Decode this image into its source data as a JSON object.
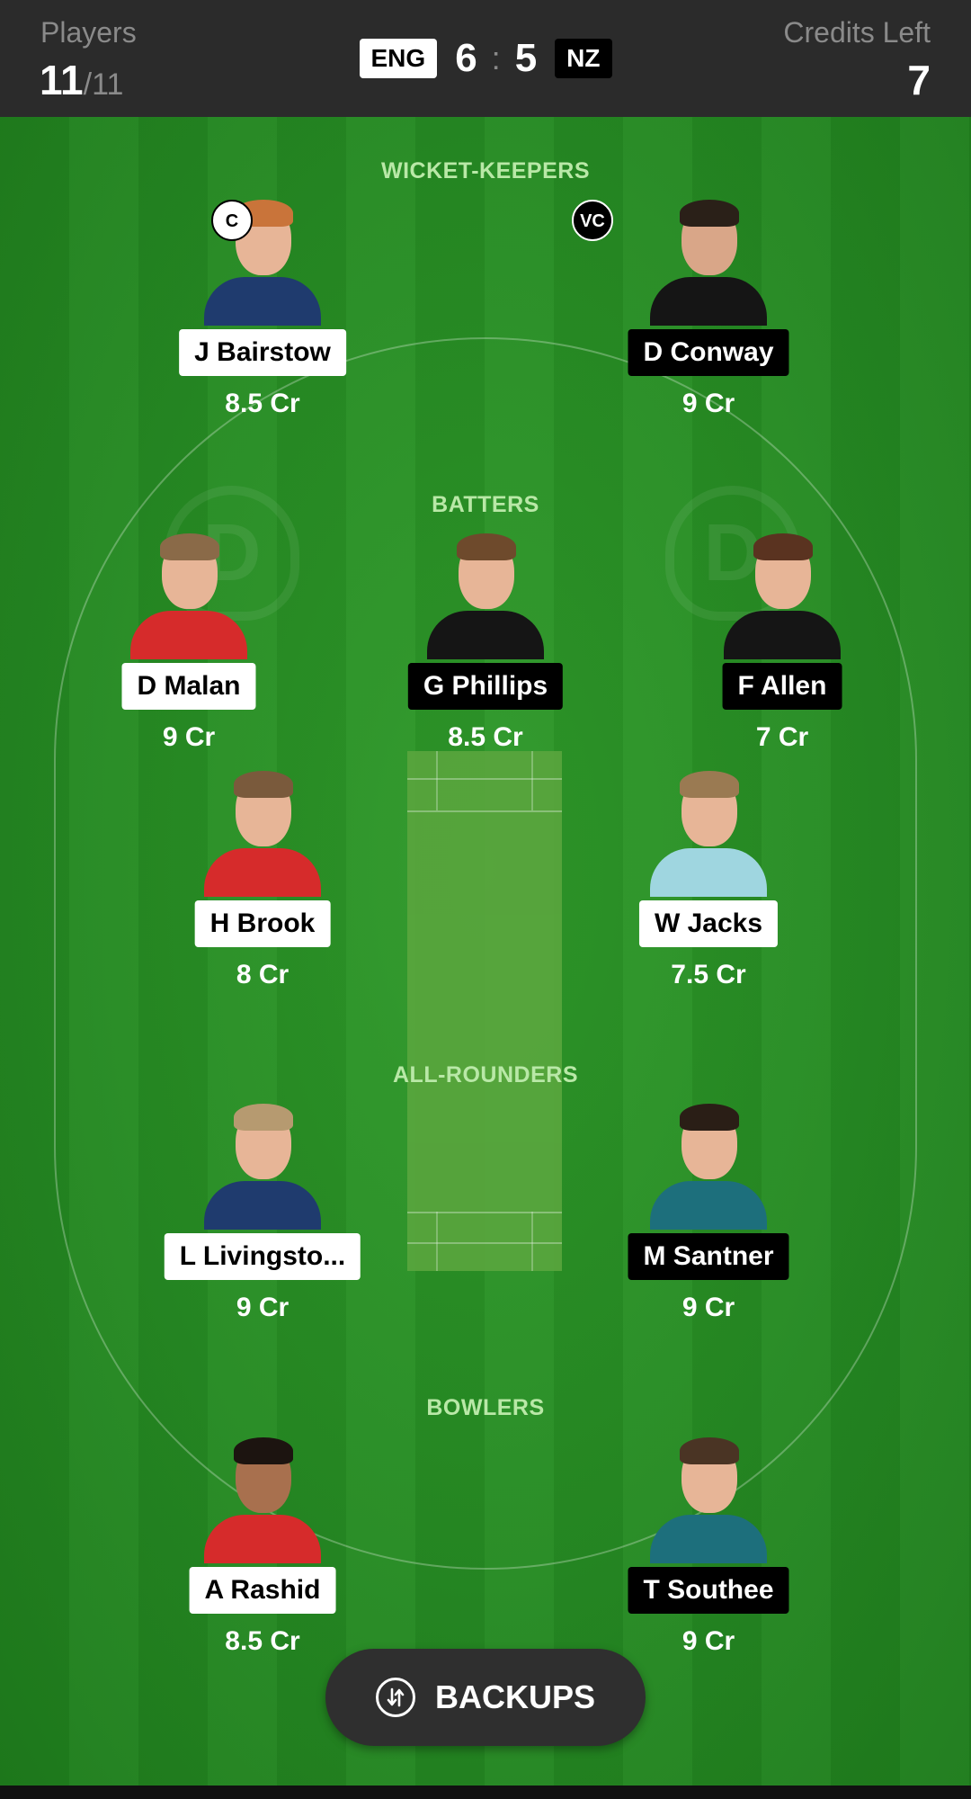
{
  "header": {
    "players_label": "Players",
    "players_count": "11",
    "players_total": "/11",
    "credits_label": "Credits Left",
    "credits_value": "7",
    "team1": "ENG",
    "team1_count": "6",
    "separator": ":",
    "team2_count": "5",
    "team2": "NZ"
  },
  "sections": {
    "wicket_keepers": "WICKET-KEEPERS",
    "batters": "BATTERS",
    "all_rounders": "ALL-ROUNDERS",
    "bowlers": "BOWLERS"
  },
  "players": [
    {
      "name": "J Bairstow",
      "credits": "8.5 Cr",
      "team": "ENG",
      "role_badge": "C"
    },
    {
      "name": "D Conway",
      "credits": "9 Cr",
      "team": "NZ",
      "role_badge": "VC"
    },
    {
      "name": "D Malan",
      "credits": "9 Cr",
      "team": "ENG"
    },
    {
      "name": "G Phillips",
      "credits": "8.5 Cr",
      "team": "NZ"
    },
    {
      "name": "F Allen",
      "credits": "7 Cr",
      "team": "NZ"
    },
    {
      "name": "H Brook",
      "credits": "8 Cr",
      "team": "ENG"
    },
    {
      "name": "W Jacks",
      "credits": "7.5 Cr",
      "team": "ENG"
    },
    {
      "name": "L Livingsto...",
      "credits": "9 Cr",
      "team": "ENG"
    },
    {
      "name": "M Santner",
      "credits": "9 Cr",
      "team": "NZ"
    },
    {
      "name": "A Rashid",
      "credits": "8.5 Cr",
      "team": "ENG"
    },
    {
      "name": "T Southee",
      "credits": "9 Cr",
      "team": "NZ"
    }
  ],
  "backups_button": {
    "label": "BACKUPS",
    "icon": "swap-arrows-icon"
  },
  "colors": {
    "header_bg": "#2b2b2b",
    "field_green": "#268b23",
    "section_label": "#b9e8a7",
    "eng_name_bg": "#ffffff",
    "nz_name_bg": "#000000"
  }
}
